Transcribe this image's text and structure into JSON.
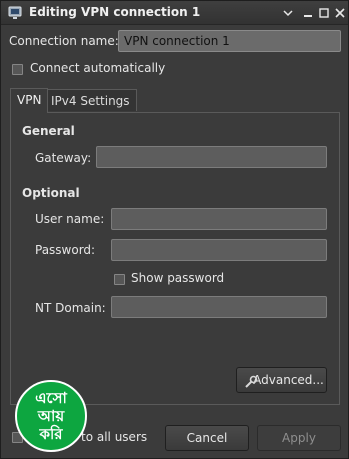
{
  "window": {
    "title": "Editing VPN connection 1",
    "buttons": {
      "minimize_icon": "chevron-down-icon",
      "restore_icon": "restore-icon",
      "close_icon": "close-icon"
    }
  },
  "connection": {
    "name_label": "Connection name:",
    "name_value": "VPN connection 1",
    "auto_label": "Connect automatically",
    "auto_checked": false
  },
  "tabs": [
    {
      "label": "VPN",
      "active": true
    },
    {
      "label": "IPv4 Settings",
      "active": false
    }
  ],
  "general": {
    "heading": "General",
    "gateway_label": "Gateway:",
    "gateway_value": ""
  },
  "optional": {
    "heading": "Optional",
    "username_label": "User name:",
    "username_value": "",
    "password_label": "Password:",
    "password_value": "",
    "show_password_label": "Show password",
    "show_password_checked": false,
    "ntdomain_label": "NT Domain:",
    "ntdomain_value": ""
  },
  "advanced_button": "Advanced...",
  "footer": {
    "all_users_label": "to all users",
    "cancel": "Cancel",
    "apply": "Apply"
  },
  "overlay_badge": {
    "line1": "এসো",
    "line2": "আয়",
    "line3": "করি"
  },
  "colors": {
    "window_bg": "#3b3b3b",
    "field_bg": "#6b6b6b",
    "badge_green": "#0da640"
  }
}
